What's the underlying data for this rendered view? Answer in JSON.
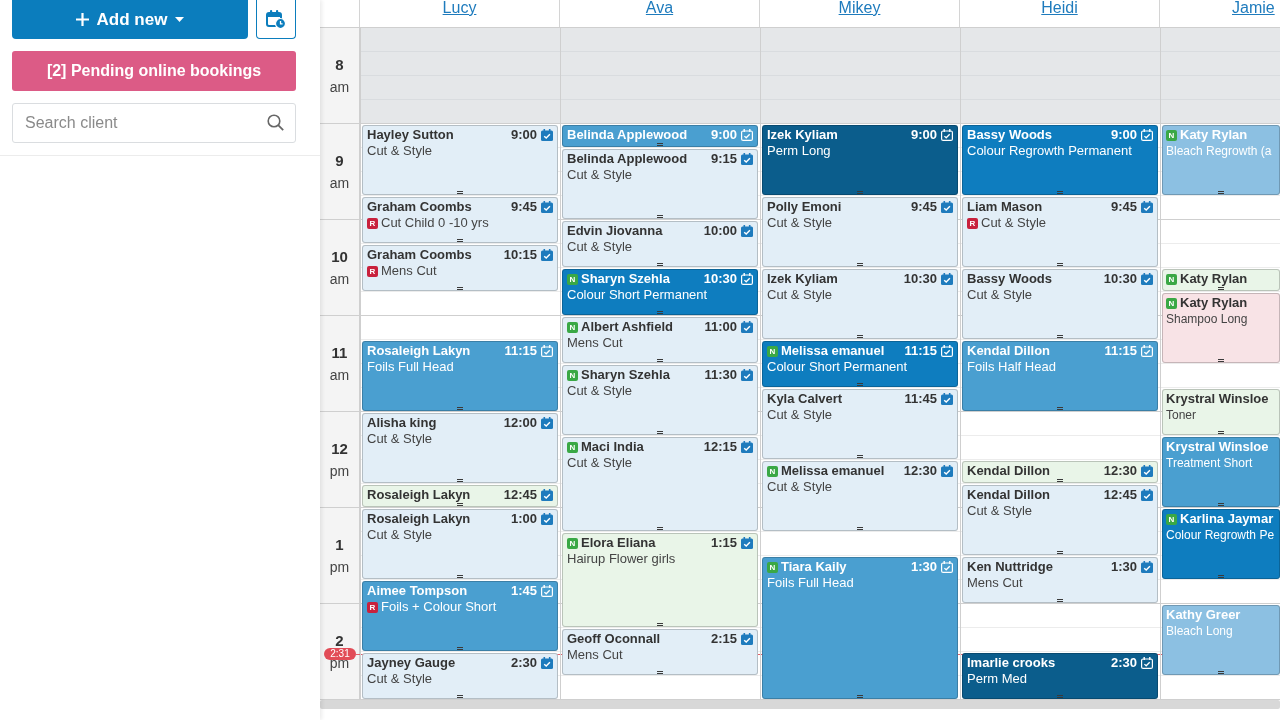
{
  "sidebar": {
    "add_button": {
      "label": "Add new"
    },
    "pending_button": {
      "label": "[2] Pending online bookings"
    },
    "search": {
      "placeholder": "Search client"
    }
  },
  "calendar": {
    "hours": [
      {
        "hour": "8",
        "period": "am",
        "closed": true
      },
      {
        "hour": "9",
        "period": "am",
        "closed": false
      },
      {
        "hour": "10",
        "period": "am",
        "closed": false
      },
      {
        "hour": "11",
        "period": "am",
        "closed": false
      },
      {
        "hour": "12",
        "period": "pm",
        "closed": false
      },
      {
        "hour": "1",
        "period": "pm",
        "closed": false
      },
      {
        "hour": "2",
        "period": "pm",
        "closed": false
      }
    ],
    "now": {
      "time": "2:31"
    },
    "staff": [
      {
        "name": "Lucy",
        "slots": [
          {
            "kind": "free"
          },
          {
            "kind": "free"
          },
          {
            "kind": "free"
          },
          {
            "kind": "free"
          },
          {
            "kind": "appointment",
            "client": "Hayley Sutton",
            "time": "9:00",
            "service": "Cut & Style",
            "color": "#e2eef7"
          },
          {
            "kind": "continued"
          },
          {
            "kind": "continued"
          },
          {
            "kind": "appointment",
            "client": "Graham Coombs",
            "time": "9:45",
            "service": "Cut Child 0 -10 yrs",
            "service_badge": {
              "text": "R",
              "color": "#c8213d"
            },
            "color": "#e2eef7"
          },
          {
            "kind": "continued"
          },
          {
            "kind": "appointment",
            "client": "Graham Coombs",
            "time": "10:15",
            "service": "Mens Cut",
            "service_badge": {
              "text": "R",
              "color": "#c8213d"
            },
            "color": "#e2eef7"
          },
          {
            "kind": "continued"
          },
          {
            "kind": "free"
          },
          {
            "kind": "free"
          },
          {
            "kind": "appointment",
            "client": "Rosaleigh Lakyn",
            "time": "11:15",
            "service": "Foils Full Head",
            "color": "#4a9fd0"
          },
          {
            "kind": "continued"
          },
          {
            "kind": "continued"
          },
          {
            "kind": "appointment",
            "client": "Alisha king",
            "time": "12:00",
            "service": "Cut & Style",
            "color": "#e2eef7"
          },
          {
            "kind": "continued"
          },
          {
            "kind": "continued"
          },
          {
            "kind": "appointment",
            "client": "Rosaleigh Lakyn",
            "time": "12:45",
            "color": "#e9f5e8"
          },
          {
            "kind": "appointment",
            "client": "Rosaleigh Lakyn",
            "time": "1:00",
            "service": "Cut & Style",
            "color": "#e2eef7"
          },
          {
            "kind": "continued"
          },
          {
            "kind": "continued"
          },
          {
            "kind": "appointment",
            "client": "Aimee Tompson",
            "time": "1:45",
            "service": "Foils + Colour Short",
            "service_badge": {
              "text": "R",
              "color": "#c8213d"
            },
            "color": "#4a9fd0"
          },
          {
            "kind": "continued"
          },
          {
            "kind": "continued"
          },
          {
            "kind": "appointment",
            "client": "Jayney Gauge",
            "time": "2:30",
            "service": "Cut & Style",
            "color": "#e2eef7"
          },
          {
            "kind": "continued"
          }
        ]
      },
      {
        "name": "Ava",
        "slots": [
          {
            "kind": "free"
          },
          {
            "kind": "free"
          },
          {
            "kind": "free"
          },
          {
            "kind": "free"
          },
          {
            "kind": "appointment",
            "client": "Belinda Applewood",
            "time": "9:00",
            "color": "#4a9fd0"
          },
          {
            "kind": "appointment",
            "client": "Belinda Applewood",
            "time": "9:15",
            "service": "Cut & Style",
            "color": "#e2eef7"
          },
          {
            "kind": "continued"
          },
          {
            "kind": "continued"
          },
          {
            "kind": "appointment",
            "client": "Edvin Jiovanna",
            "time": "10:00",
            "service": "Cut & Style",
            "color": "#e2eef7"
          },
          {
            "kind": "continued"
          },
          {
            "kind": "appointment",
            "client": "Sharyn Szehla",
            "client_badge": {
              "text": "N",
              "color": "#3aa845"
            },
            "time": "10:30",
            "service": "Colour Short Permanent",
            "color": "#0e7dbf"
          },
          {
            "kind": "continued"
          },
          {
            "kind": "appointment",
            "client": "Albert Ashfield",
            "client_badge": {
              "text": "N",
              "color": "#3aa845"
            },
            "time": "11:00",
            "service": "Mens Cut",
            "color": "#e2eef7"
          },
          {
            "kind": "continued"
          },
          {
            "kind": "appointment",
            "client": "Sharyn Szehla",
            "client_badge": {
              "text": "N",
              "color": "#3aa845"
            },
            "time": "11:30",
            "service": "Cut & Style",
            "color": "#e2eef7"
          },
          {
            "kind": "continued"
          },
          {
            "kind": "continued"
          },
          {
            "kind": "appointment",
            "client": "Maci India",
            "client_badge": {
              "text": "N",
              "color": "#3aa845"
            },
            "time": "12:15",
            "service": "Cut & Style",
            "color": "#e2eef7"
          },
          {
            "kind": "continued"
          },
          {
            "kind": "continued"
          },
          {
            "kind": "continued"
          },
          {
            "kind": "appointment",
            "client": "Elora Eliana",
            "client_badge": {
              "text": "N",
              "color": "#3aa845"
            },
            "time": "1:15",
            "service": "Hairup Flower girls",
            "color": "#e9f5e8"
          },
          {
            "kind": "continued"
          },
          {
            "kind": "continued"
          },
          {
            "kind": "continued"
          },
          {
            "kind": "appointment",
            "client": "Geoff Oconnall",
            "time": "2:15",
            "service": "Mens Cut",
            "color": "#e2eef7"
          },
          {
            "kind": "continued"
          },
          {
            "kind": "free"
          }
        ]
      },
      {
        "name": "Mikey",
        "slots": [
          {
            "kind": "free"
          },
          {
            "kind": "free"
          },
          {
            "kind": "free"
          },
          {
            "kind": "free"
          },
          {
            "kind": "appointment",
            "client": "Izek Kyliam",
            "time": "9:00",
            "service": "Perm Long",
            "color": "#0b5d8c"
          },
          {
            "kind": "continued"
          },
          {
            "kind": "continued"
          },
          {
            "kind": "appointment",
            "client": "Polly Emoni",
            "time": "9:45",
            "service": "Cut & Style",
            "color": "#e2eef7"
          },
          {
            "kind": "continued"
          },
          {
            "kind": "continued"
          },
          {
            "kind": "appointment",
            "client": "Izek Kyliam",
            "time": "10:30",
            "service": "Cut & Style",
            "color": "#e2eef7"
          },
          {
            "kind": "continued"
          },
          {
            "kind": "continued"
          },
          {
            "kind": "appointment",
            "client": "Melissa emanuel",
            "client_badge": {
              "text": "N",
              "color": "#3aa845"
            },
            "time": "11:15",
            "service": "Colour Short Permanent",
            "color": "#0e7dbf"
          },
          {
            "kind": "continued"
          },
          {
            "kind": "appointment",
            "client": "Kyla Calvert",
            "time": "11:45",
            "service": "Cut & Style",
            "color": "#e2eef7"
          },
          {
            "kind": "continued"
          },
          {
            "kind": "continued"
          },
          {
            "kind": "appointment",
            "client": "Melissa emanuel",
            "client_badge": {
              "text": "N",
              "color": "#3aa845"
            },
            "time": "12:30",
            "service": "Cut & Style",
            "color": "#e2eef7"
          },
          {
            "kind": "continued"
          },
          {
            "kind": "continued"
          },
          {
            "kind": "free"
          },
          {
            "kind": "appointment",
            "client": "Tiara Kaily",
            "client_badge": {
              "text": "N",
              "color": "#3aa845"
            },
            "time": "1:30",
            "service": "Foils Full Head",
            "color": "#4a9fd0"
          },
          {
            "kind": "continued"
          },
          {
            "kind": "continued"
          },
          {
            "kind": "continued"
          },
          {
            "kind": "continued"
          },
          {
            "kind": "continued"
          }
        ]
      },
      {
        "name": "Heidi",
        "slots": [
          {
            "kind": "free"
          },
          {
            "kind": "free"
          },
          {
            "kind": "free"
          },
          {
            "kind": "free"
          },
          {
            "kind": "appointment",
            "client": "Bassy Woods",
            "time": "9:00",
            "service": "Colour Regrowth Permanent",
            "color": "#0e7dbf"
          },
          {
            "kind": "continued"
          },
          {
            "kind": "continued"
          },
          {
            "kind": "appointment",
            "client": "Liam Mason",
            "time": "9:45",
            "service": "Cut & Style",
            "service_badge": {
              "text": "R",
              "color": "#c8213d"
            },
            "color": "#e2eef7"
          },
          {
            "kind": "continued"
          },
          {
            "kind": "continued"
          },
          {
            "kind": "appointment",
            "client": "Bassy Woods",
            "time": "10:30",
            "service": "Cut & Style",
            "color": "#e2eef7"
          },
          {
            "kind": "continued"
          },
          {
            "kind": "continued"
          },
          {
            "kind": "appointment",
            "client": "Kendal Dillon",
            "time": "11:15",
            "service": "Foils Half Head",
            "color": "#4a9fd0"
          },
          {
            "kind": "continued"
          },
          {
            "kind": "continued"
          },
          {
            "kind": "free"
          },
          {
            "kind": "free"
          },
          {
            "kind": "appointment",
            "client": "Kendal Dillon",
            "time": "12:30",
            "color": "#e9f5e8"
          },
          {
            "kind": "appointment",
            "client": "Kendal Dillon",
            "time": "12:45",
            "service": "Cut & Style",
            "color": "#e2eef7"
          },
          {
            "kind": "continued"
          },
          {
            "kind": "continued"
          },
          {
            "kind": "appointment",
            "client": "Ken Nuttridge",
            "time": "1:30",
            "service": "Mens Cut",
            "color": "#e2eef7"
          },
          {
            "kind": "continued"
          },
          {
            "kind": "free"
          },
          {
            "kind": "free"
          },
          {
            "kind": "appointment",
            "client": "Imarlie crooks",
            "time": "2:30",
            "service": "Perm Med",
            "color": "#0b5d8c"
          },
          {
            "kind": "continued"
          }
        ]
      },
      {
        "name": "Jamie",
        "slots": [
          {
            "kind": "free"
          },
          {
            "kind": "free"
          },
          {
            "kind": "free"
          },
          {
            "kind": "free"
          },
          {
            "kind": "appointment",
            "client": "Katy Rylan",
            "client_badge": {
              "text": "N",
              "color": "#3aa845"
            },
            "service": "Bleach Regrowth (a",
            "color": "#8cc0e2"
          },
          {
            "kind": "continued"
          },
          {
            "kind": "continued"
          },
          {
            "kind": "free"
          },
          {
            "kind": "free"
          },
          {
            "kind": "free"
          },
          {
            "kind": "appointment",
            "client": "Katy Rylan",
            "client_badge": {
              "text": "N",
              "color": "#3aa845"
            },
            "color": "#e9f5e8"
          },
          {
            "kind": "appointment",
            "client": "Katy Rylan",
            "client_badge": {
              "text": "N",
              "color": "#3aa845"
            },
            "service": "Shampoo Long",
            "color": "#f8e3e6"
          },
          {
            "kind": "continued"
          },
          {
            "kind": "continued"
          },
          {
            "kind": "free"
          },
          {
            "kind": "appointment",
            "client": "Krystral Winsloe",
            "service": "Toner",
            "color": "#e9f5e8"
          },
          {
            "kind": "continued"
          },
          {
            "kind": "appointment",
            "client": "Krystral Winsloe",
            "service": "Treatment Short",
            "color": "#4a9fd0"
          },
          {
            "kind": "continued"
          },
          {
            "kind": "continued"
          },
          {
            "kind": "appointment",
            "client": "Karlina Jaymar",
            "client_badge": {
              "text": "N",
              "color": "#3aa845"
            },
            "service": "Colour Regrowth Pe",
            "color": "#0e7dbf"
          },
          {
            "kind": "continued"
          },
          {
            "kind": "continued"
          },
          {
            "kind": "free"
          },
          {
            "kind": "appointment",
            "client": "Kathy Greer",
            "service": "Bleach Long",
            "color": "#8cc0e2"
          },
          {
            "kind": "continued"
          },
          {
            "kind": "continued"
          },
          {
            "kind": "free"
          }
        ]
      }
    ]
  }
}
